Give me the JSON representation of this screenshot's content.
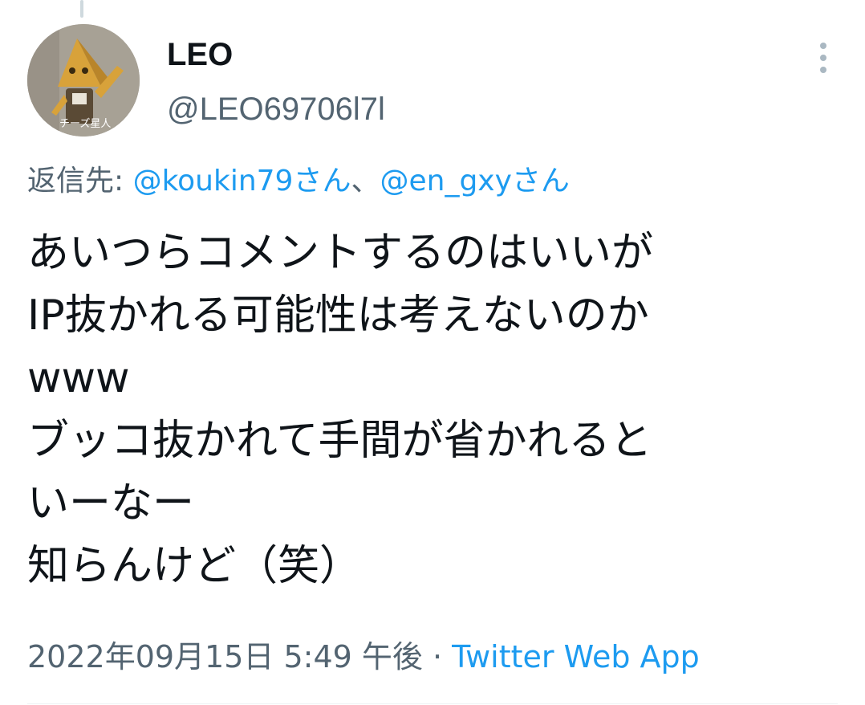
{
  "tweet": {
    "author": {
      "display_name": "LEO",
      "handle": "@LEO69706l7l",
      "avatar_caption": "チーズ星人"
    },
    "reply_to": {
      "prefix": "返信先: ",
      "mentions": [
        "@koukin79さん",
        "@en_gxyさん"
      ],
      "separator": "、"
    },
    "text_lines": [
      "あいつらコメントするのはいいが",
      "IP抜かれる可能性は考えないのか",
      "www",
      "ブッコ抜かれて手間が省かれると",
      "いーなー",
      "知らんけど（笑）"
    ],
    "timestamp": "2022年09月15日 5:49 午後",
    "separator_dot": " · ",
    "source": "Twitter Web App"
  },
  "icons": {
    "more": "more-vertical-icon"
  },
  "colors": {
    "link": "#1d9bf0",
    "secondary_text": "#536471",
    "primary_text": "#0f1419"
  }
}
